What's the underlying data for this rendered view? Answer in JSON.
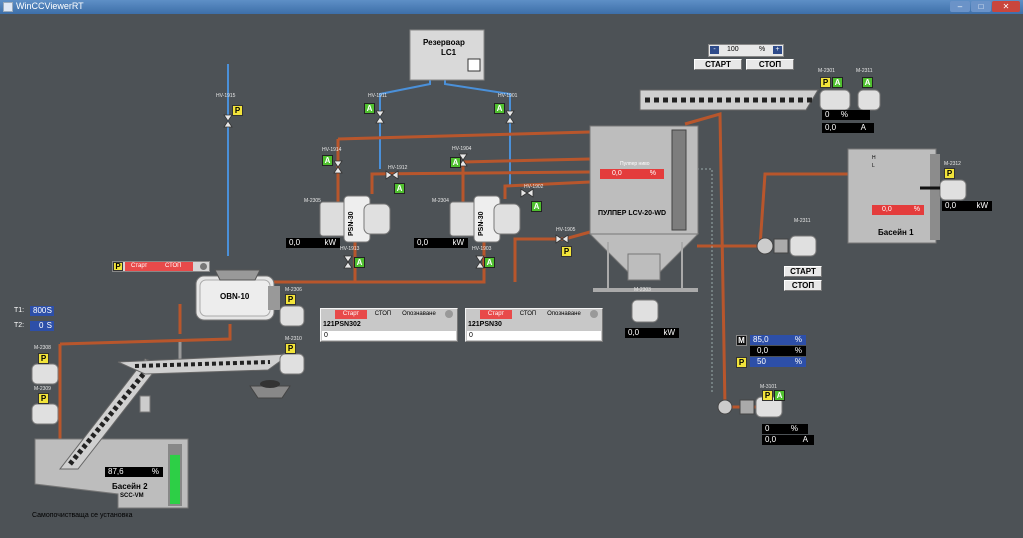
{
  "window": {
    "title": "WinCCViewerRT",
    "minimize": "–",
    "maximize": "□",
    "close": "✕"
  },
  "icons": {
    "app": "application-icon",
    "valve": "valve-icon",
    "motor": "motor-icon",
    "pump": "pump-icon"
  },
  "colors": {
    "background": "#4d5256",
    "pipe": "#b8562c",
    "water": "#4a90d9",
    "tank_fill": "#bdbdbd",
    "green_level": "#2dcf46"
  },
  "tank_lc1": {
    "name": "Резервоар",
    "sub": "LC1"
  },
  "speed": {
    "value": "100",
    "unit": "%",
    "minus": "-",
    "plus": "+"
  },
  "top_buttons": {
    "start": "СТАРТ",
    "stop": "СТОП"
  },
  "pulper": {
    "name": "ПУЛПЕР LCV-20-WD",
    "value": "0,0",
    "unit": "%",
    "header_label": "Пулпер ниво"
  },
  "basin1": {
    "name": "Басейн 1",
    "value": "0,0",
    "unit": "%",
    "h": "H",
    "l": "L"
  },
  "basin2": {
    "name": "Басейн 2",
    "sub": "SCC-VM",
    "value": "87,6",
    "unit": "%",
    "level": 0.876
  },
  "selfclean_label": "Самопочистваща се установка",
  "obn": {
    "name": "OBN-10",
    "label": "Старт",
    "stop": "СТОП"
  },
  "psn_left": {
    "name": "PSN-30",
    "motor": "M-2305",
    "value": "0,0",
    "unit": "kW"
  },
  "psn_right": {
    "name": "PSN-30",
    "motor": "M-2304",
    "value": "0,0",
    "unit": "kW"
  },
  "timers": [
    {
      "label": "T1:",
      "value": "800",
      "unit": "S"
    },
    {
      "label": "T2:",
      "value": "0",
      "unit": "S"
    }
  ],
  "panel_left": {
    "name": "121PSN302",
    "start": "Старт",
    "stop": "СТОП",
    "reset": "Опознаване",
    "row": "0"
  },
  "panel_right": {
    "name": "121PSN30",
    "start": "Старт",
    "stop": "СТОП",
    "reset": "Опознаване",
    "row": "0"
  },
  "pump_m2311": {
    "name": "M-2311",
    "start": "СТАРТ",
    "stop": "СТОП"
  },
  "motor_m2301": {
    "name": "M-2301",
    "m2311": "M-2311",
    "pct": "0",
    "pct_unit": "%",
    "amp": "0,0",
    "amp_unit": "A"
  },
  "motor_m2312": {
    "name": "M-2312",
    "value": "0,0",
    "unit": "kW"
  },
  "motor_m2303": {
    "name": "M-2303",
    "value": "0,0",
    "unit": "kW"
  },
  "motor_m3101": {
    "name": "M-3101",
    "pct": "0",
    "pct_unit": "%",
    "amp": "0,0",
    "amp_unit": "A"
  },
  "mpp_panel": {
    "m": "M",
    "m_value": "85,0",
    "m_unit": "%",
    "mid_value": "0,0",
    "mid_unit": "%",
    "p": "P",
    "p_value": "50",
    "p_unit": "%"
  },
  "valves": {
    "hv1915": "HV-1915",
    "hv1911": "HV-1911",
    "hv1901": "HV-1901",
    "hv1914": "HV-1914",
    "hv1904": "HV-1904",
    "hv1912": "HV-1912",
    "hv1902": "HV-1902",
    "hv1913": "HV-1913",
    "hv1903": "HV-1903",
    "hv1905": "HV-1905"
  },
  "motors_small": {
    "m2306": "M-2306",
    "m2310": "M-2310",
    "m2308": "M-2308",
    "m2309": "M-2309"
  },
  "badges": {
    "p": "P",
    "a": "A"
  }
}
